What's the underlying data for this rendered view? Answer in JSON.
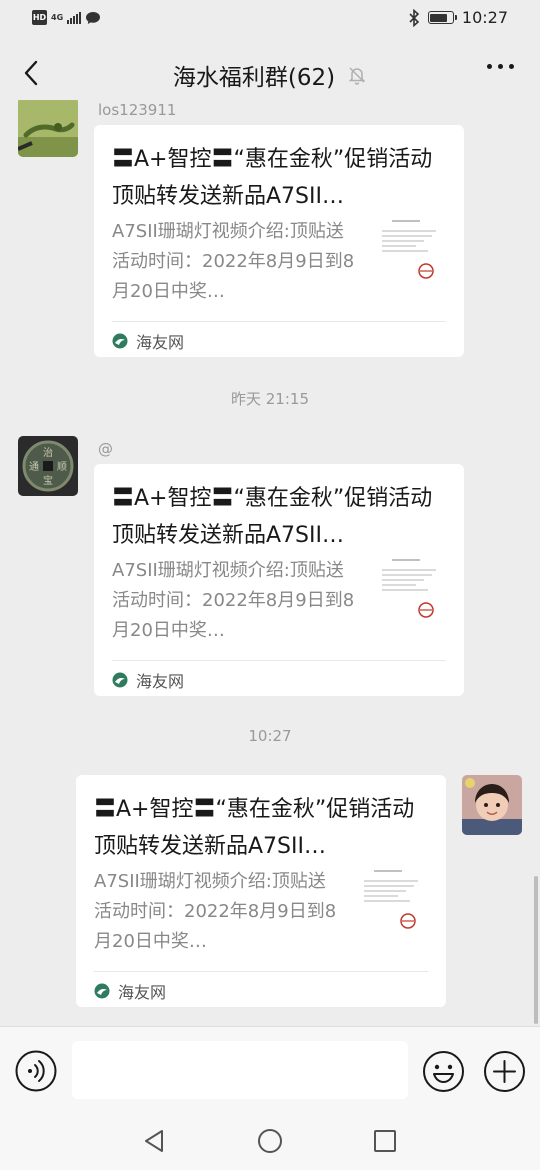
{
  "status_bar": {
    "hd": "HD",
    "network": "4G",
    "time": "10:27"
  },
  "nav": {
    "title": "海水福利群(62)"
  },
  "messages": [
    {
      "sender": "los123911",
      "card": {
        "title": "〓A+智控〓“惠在金秋”促销活动顶贴转发送新品A7SII…",
        "desc": "A7SII珊瑚灯视频介绍:顶贴送活动时间：2022年8月9日到8月20日中奖…",
        "source": "海友网"
      }
    },
    {
      "sender": "@",
      "card": {
        "title": "〓A+智控〓“惠在金秋”促销活动顶贴转发送新品A7SII…",
        "desc": "A7SII珊瑚灯视频介绍:顶贴送活动时间：2022年8月9日到8月20日中奖…",
        "source": "海友网"
      }
    },
    {
      "sender": "",
      "card": {
        "title": "〓A+智控〓“惠在金秋”促销活动顶贴转发送新品A7SII…",
        "desc": "A7SII珊瑚灯视频介绍:顶贴送活动时间：2022年8月9日到8月20日中奖…",
        "source": "海友网"
      }
    }
  ],
  "timestamps": [
    "昨天 21:15",
    "10:27"
  ],
  "input": {
    "value": "",
    "placeholder": ""
  },
  "icons": {
    "back": "chevron-left-icon",
    "mute": "bell-off-icon",
    "more": "more-horizontal-icon",
    "voice": "voice-icon",
    "emoji": "emoji-icon",
    "plus": "plus-icon",
    "source": "source-logo-icon"
  },
  "colors": {
    "background": "#ededed",
    "card": "#ffffff",
    "input_bar": "#f7f7f7",
    "source_logo": "#2f7b5f"
  }
}
